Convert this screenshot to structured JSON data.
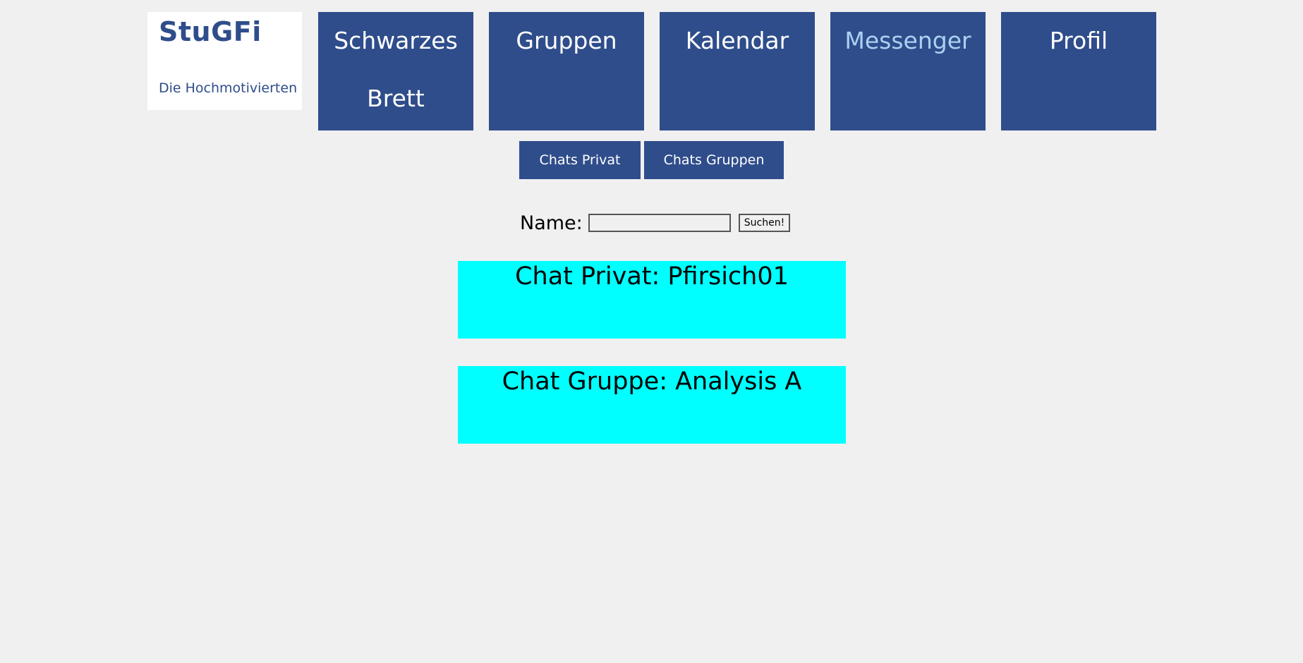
{
  "logo": {
    "title": "StuGFi",
    "subtitle": "Die Hochmotivierten"
  },
  "nav": {
    "items": [
      {
        "label_line1": "Schwarzes",
        "label_line2": "Brett"
      },
      {
        "label_line1": "Gruppen"
      },
      {
        "label_line1": "Kalendar"
      },
      {
        "label_line1": "Messenger",
        "active": true
      },
      {
        "label_line1": "Profil"
      }
    ]
  },
  "subnav": {
    "private_label": "Chats Privat",
    "groups_label": "Chats Gruppen"
  },
  "search": {
    "label": "Name:",
    "value": "",
    "button_label": "Suchen!"
  },
  "chats": [
    {
      "label": "Chat Privat: Pfirsich01"
    },
    {
      "label": "Chat Gruppe: Analysis A"
    }
  ],
  "colors": {
    "nav_bg": "#2f4d8b",
    "nav_active_text": "#a9d2f2",
    "chat_bg": "#00ffff",
    "page_bg": "#f0f0f0"
  }
}
